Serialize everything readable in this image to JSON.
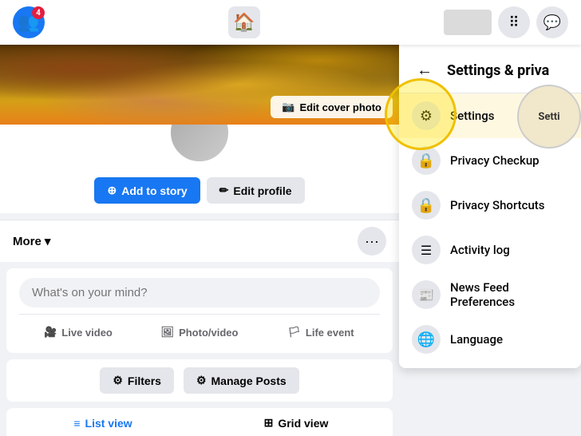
{
  "topbar": {
    "notification_badge": "4",
    "profile_placeholder": "profile"
  },
  "cover": {
    "edit_button_label": "Edit cover photo",
    "camera_icon": "📷"
  },
  "profile": {
    "add_story_label": "Add to story",
    "edit_profile_label": "Edit profile",
    "plus_icon": "⊕",
    "pencil_icon": "✏"
  },
  "more_bar": {
    "label": "More",
    "chevron_icon": "▾",
    "dots_icon": "···"
  },
  "whats_on_mind": {
    "placeholder": "What's on your mind?"
  },
  "post_options": [
    {
      "icon": "🎥",
      "label": "Live video"
    },
    {
      "icon": "🖼",
      "label": "Photo/video"
    },
    {
      "icon": "🏳",
      "label": "Life event"
    }
  ],
  "filters_row": {
    "filters_label": "Filters",
    "manage_posts_label": "Manage Posts",
    "filter_icon": "⚙",
    "manage_icon": "⚙"
  },
  "view_tabs": [
    {
      "id": "list-view",
      "icon": "≡",
      "label": "List view",
      "active": true
    },
    {
      "id": "grid-view",
      "icon": "⊞",
      "label": "Grid view",
      "active": false
    }
  ],
  "dropdown": {
    "title": "Settings & priva",
    "back_icon": "←",
    "items": [
      {
        "id": "settings",
        "icon": "⚙",
        "label": "Settings",
        "highlighted": true
      },
      {
        "id": "privacy-checkup",
        "icon": "🔒",
        "label": "Privacy Checkup"
      },
      {
        "id": "privacy-shortcuts",
        "icon": "🔒",
        "label": "Privacy Shortcuts"
      },
      {
        "id": "activity-log",
        "icon": "☰",
        "label": "Activity log"
      },
      {
        "id": "news-feed-prefs",
        "icon": "📰",
        "label": "News Feed Preferences"
      },
      {
        "id": "language",
        "icon": "🌐",
        "label": "Language"
      }
    ]
  },
  "highlight": {
    "label": "Setti"
  }
}
